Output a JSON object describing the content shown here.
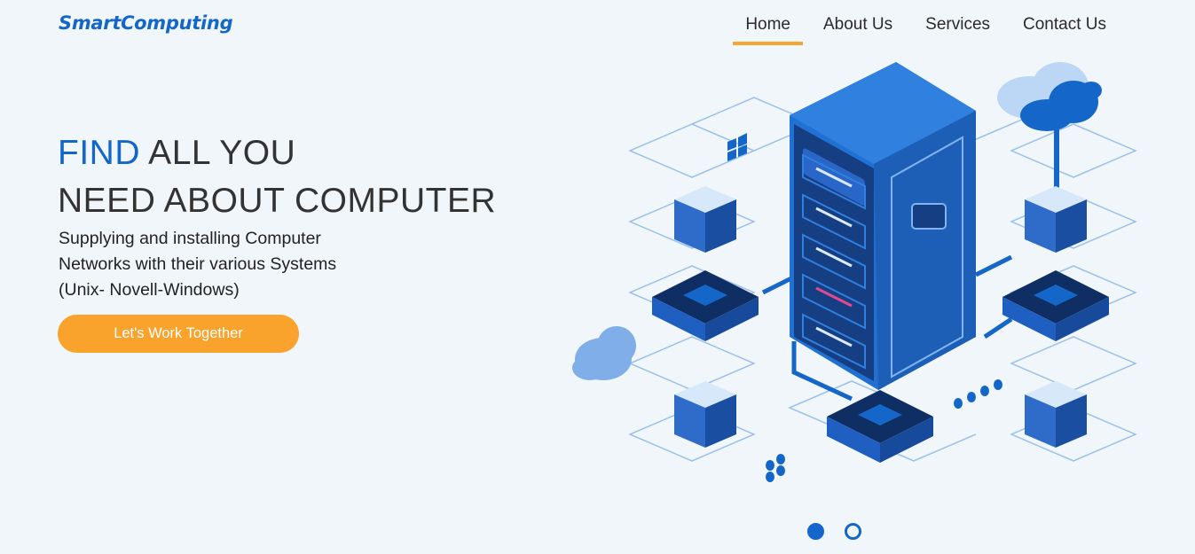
{
  "brand": {
    "name": "SmartComputing"
  },
  "nav": {
    "items": [
      {
        "label": "Home",
        "active": true
      },
      {
        "label": "About Us",
        "active": false
      },
      {
        "label": "Services",
        "active": false
      },
      {
        "label": "Contact Us",
        "active": false
      }
    ]
  },
  "hero": {
    "title_accent": "FIND",
    "title_rest_line1": " ALL YOU",
    "title_line2": "NEED ABOUT COMPUTER",
    "subtitle_line1": "Supplying and installing Computer",
    "subtitle_line2": "Networks with their various Systems",
    "subtitle_line3": "(Unix- Novell-Windows)",
    "cta_label": "Let's Work Together"
  },
  "carousel": {
    "slide_count": 2,
    "active_index": 0
  },
  "colors": {
    "brand": "#1467c8",
    "accent": "#f7a531",
    "cta": "#f9a22c",
    "background": "#f1f6fa"
  },
  "icons": [
    "server-rack-illustration",
    "cloud-icon",
    "windows-icon"
  ]
}
